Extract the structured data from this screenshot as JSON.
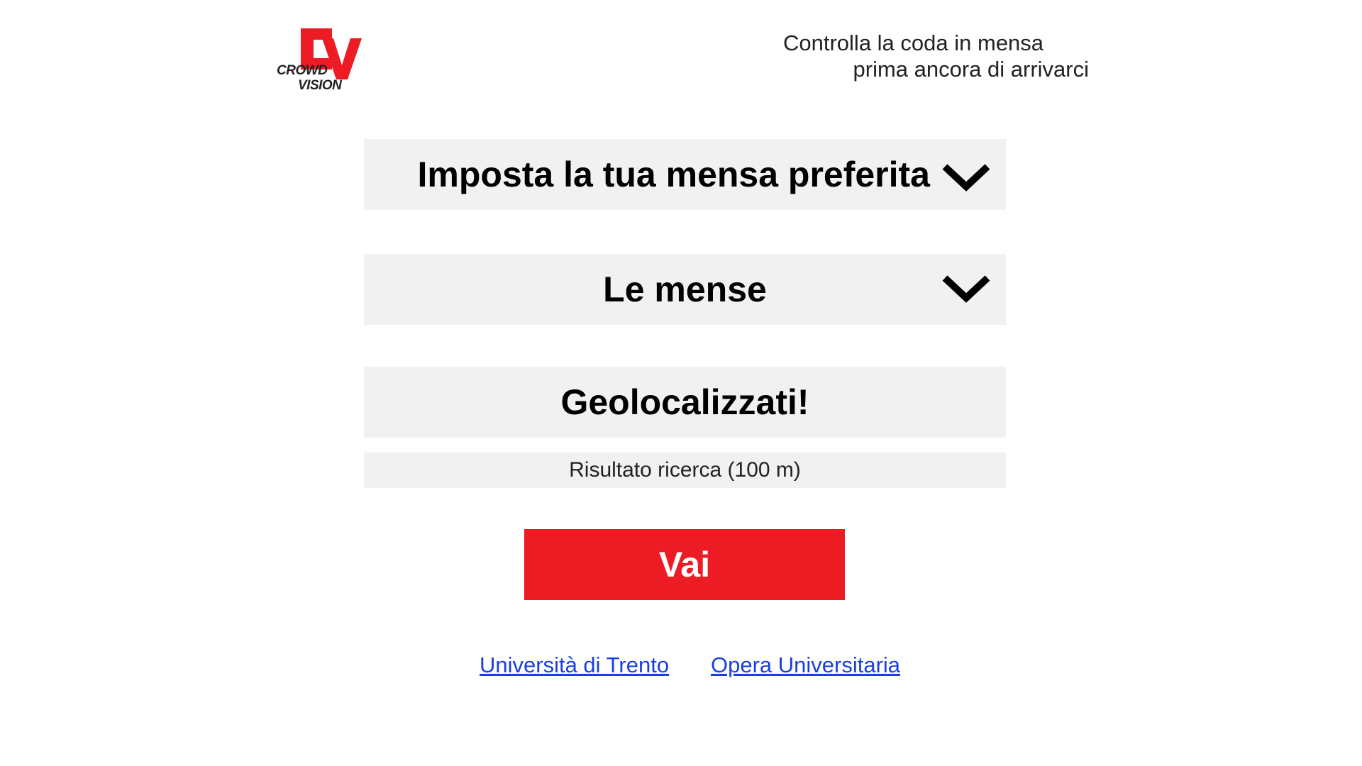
{
  "header": {
    "logo": {
      "mark": "CV",
      "word_top": "CROWD",
      "word_bottom": "VISION",
      "colors": {
        "red": "#ed1c24",
        "dark": "#231f20"
      }
    },
    "tagline_line1": "Controlla la coda in mensa",
    "tagline_line2": "prima ancora di arrivarci"
  },
  "main": {
    "favorite_dropdown": {
      "label": "Imposta la tua mensa preferita",
      "icon": "chevron-down-icon"
    },
    "canteens_dropdown": {
      "label": "Le mense",
      "icon": "chevron-down-icon"
    },
    "geolocate_button": {
      "label": "Geolocalizzati!"
    },
    "search_result": {
      "text": "Risultato ricerca (100 m)"
    },
    "go_button": {
      "label": "Vai",
      "color": "#ed1c24"
    }
  },
  "footer": {
    "links": [
      {
        "label": "Università di Trento"
      },
      {
        "label": "Opera Universitaria"
      }
    ],
    "link_color": "#1a3fe0"
  },
  "colors": {
    "panel_bg": "#f1f1f1",
    "accent": "#ed1c24",
    "text": "#000000"
  }
}
